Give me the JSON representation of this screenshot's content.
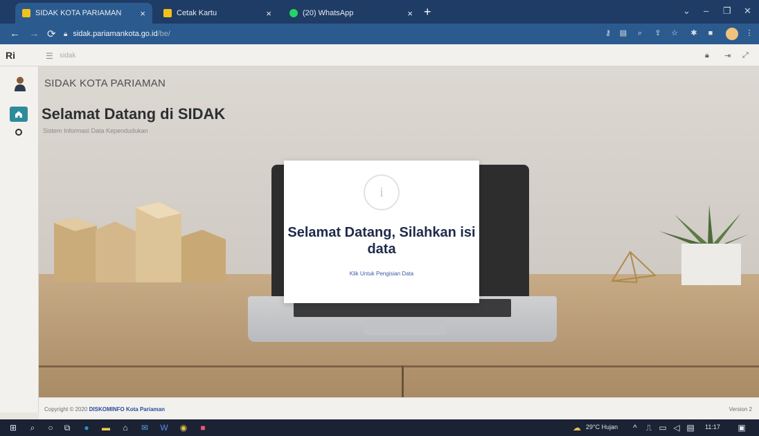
{
  "browser": {
    "tabs": [
      {
        "title": "SIDAK KOTA PARIAMAN",
        "active": true,
        "favicon_color": "#f2c21b"
      },
      {
        "title": "Cetak Kartu",
        "active": false,
        "favicon_color": "#f2c21b"
      },
      {
        "title": "(20) WhatsApp",
        "active": false,
        "favicon_color": "#25d366"
      }
    ],
    "new_tab_label": "+",
    "url_host": "sidak.pariamankota.go.id",
    "url_path": "/be/"
  },
  "app": {
    "brand": "Ri",
    "breadcrumb": "sidak"
  },
  "page": {
    "site_title": "SIDAK KOTA PARIAMAN",
    "welcome_title": "Selamat Datang di SIDAK",
    "welcome_subtitle": "Sistem Informasi Data Kependudukan"
  },
  "modal": {
    "icon_glyph": "i",
    "title": "Selamat Datang, Silahkan isi data",
    "button_label": "Klik Untuk Pengisian Data"
  },
  "footer": {
    "copyright_prefix": "Copyright © 2020",
    "organization": "DISKOMINFO Kota Pariaman",
    "version": "Version 2"
  },
  "taskbar": {
    "weather": "29°C Hujan",
    "time": "11:17"
  },
  "colors": {
    "browser_frame": "#1f3c66",
    "sidebar_active": "#2e8b9a",
    "modal_title": "#1e2a4a",
    "modal_link": "#3d5aa6"
  }
}
